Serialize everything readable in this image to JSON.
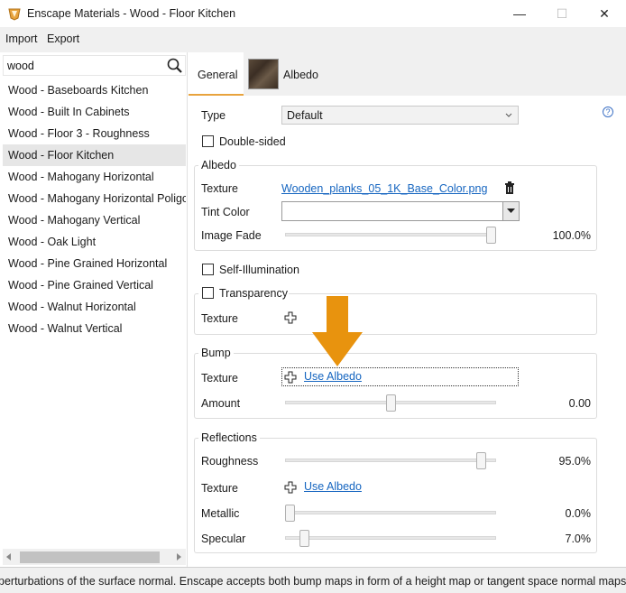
{
  "window": {
    "title": "Enscape Materials - Wood - Floor Kitchen",
    "minimize_symbol": "—",
    "maximize_symbol": "☐",
    "close_symbol": "✕"
  },
  "menu": {
    "import": "Import",
    "export": "Export"
  },
  "search": {
    "value": "wood"
  },
  "materials": [
    "Wood - Baseboards Kitchen",
    "Wood - Built In Cabinets",
    "Wood - Floor 3 - Roughness",
    "Wood - Floor Kitchen",
    "Wood - Mahogany Horizontal",
    "Wood - Mahogany Horizontal Poligon",
    "Wood - Mahogany Vertical",
    "Wood - Oak Light",
    "Wood - Pine Grained Horizontal",
    "Wood - Pine Grained Vertical",
    "Wood - Walnut Horizontal",
    "Wood - Walnut Vertical"
  ],
  "selected_material": "Wood - Floor Kitchen",
  "tabs": {
    "general": "General",
    "albedo": "Albedo"
  },
  "help_icon": "?",
  "type": {
    "label": "Type",
    "value": "Default"
  },
  "double_sided": {
    "label": "Double-sided",
    "checked": false
  },
  "albedo": {
    "title": "Albedo",
    "texture_label": "Texture",
    "texture_file": "Wooden_planks_05_1K_Base_Color.png",
    "tint_label": "Tint Color",
    "fade_label": "Image Fade",
    "fade_value": "100.0%",
    "fade_fraction": 1.0
  },
  "self_illumination": {
    "label": "Self-Illumination",
    "checked": false
  },
  "transparency": {
    "label": "Transparency",
    "checked": false,
    "texture_label": "Texture"
  },
  "bump": {
    "title": "Bump",
    "texture_label": "Texture",
    "texture_link": "Use Albedo",
    "amount_label": "Amount",
    "amount_value": "0.00",
    "amount_fraction": 0.5
  },
  "reflections": {
    "title": "Reflections",
    "roughness_label": "Roughness",
    "roughness_value": "95.0%",
    "roughness_fraction": 0.95,
    "texture_label": "Texture",
    "texture_link": "Use Albedo",
    "metallic_label": "Metallic",
    "metallic_value": "0.0%",
    "metallic_fraction": 0.0,
    "specular_label": "Specular",
    "specular_value": "7.0%",
    "specular_fraction": 0.07
  },
  "status_text": "perturbations of the surface normal. Enscape accepts both bump maps in form of a height map or tangent space normal maps wher",
  "colors": {
    "accent_orange": "#e8930e",
    "link_blue": "#1565c0",
    "tab_underline": "#e8a33d"
  }
}
